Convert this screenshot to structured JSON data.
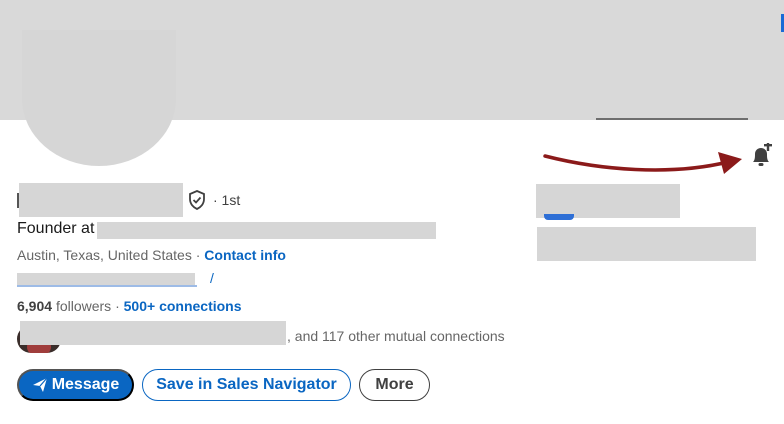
{
  "profile": {
    "degree": "· 1st",
    "headline_prefix": "Founder at",
    "location": "Austin, Texas, United States",
    "separator": " · ",
    "contact_link": "Contact info",
    "website_suffix": "/",
    "followers_count": "6,904",
    "followers_label": "followers",
    "stats_separator": " · ",
    "connections_link": "500+ connections",
    "mutual_text": ", and 117 other mutual connections"
  },
  "actions": {
    "message_label": "Message",
    "sales_label": "Save in Sales Navigator",
    "more_label": "More"
  },
  "icons": {
    "verified": "shield-check-icon",
    "send": "paper-plane-icon",
    "notify": "bell-plus-icon"
  },
  "colors": {
    "link": "#0a66c2",
    "annotation_arrow": "#8b1a1a"
  }
}
